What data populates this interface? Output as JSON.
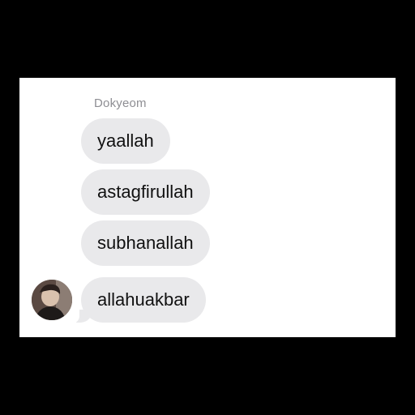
{
  "conversation": {
    "sender_name": "Dokyeom",
    "messages": [
      {
        "text": "yaallah"
      },
      {
        "text": "astagfirullah"
      },
      {
        "text": "subhanallah"
      },
      {
        "text": "allahuakbar"
      }
    ],
    "avatar_icon": "profile-photo-avatar"
  },
  "colors": {
    "bubble_background": "#e9e9eb",
    "sender_name_color": "#8e8e93",
    "page_background": "#ffffff",
    "frame_background": "#000000"
  }
}
